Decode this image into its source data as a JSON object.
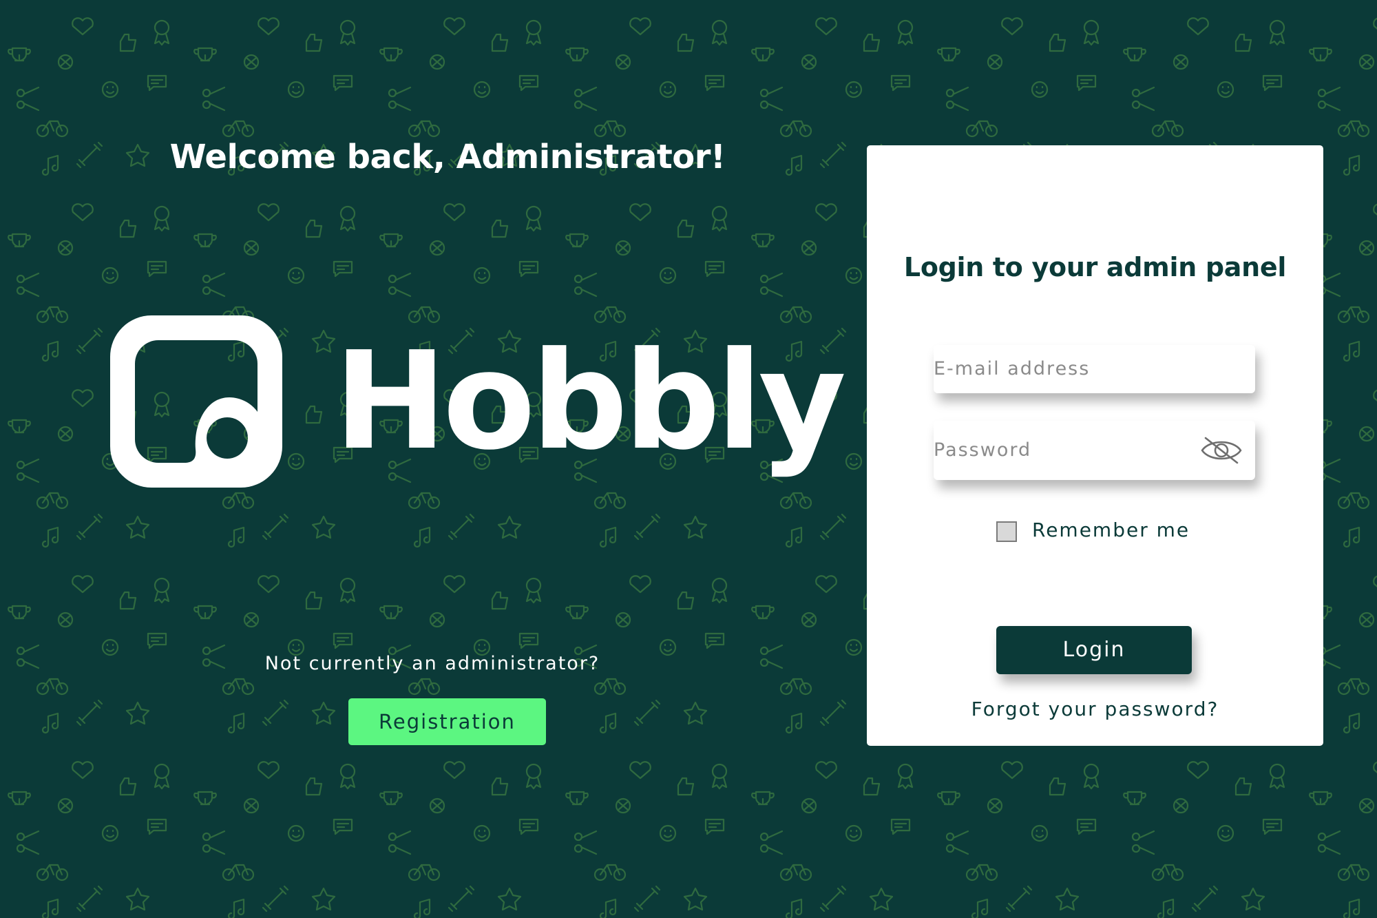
{
  "colors": {
    "background": "#0b3a38",
    "pattern": "#2f6a3f",
    "accent_green": "#5cf681",
    "card": "#ffffff",
    "dark_text": "#0b3a38"
  },
  "left_panel": {
    "welcome": "Welcome back, Administrator!",
    "brand_name": "Hobbly",
    "not_admin_text": "Not currently an administrator?",
    "registration_label": "Registration"
  },
  "login_card": {
    "title": "Login to your admin panel",
    "email_placeholder": "E-mail address",
    "password_placeholder": "Password",
    "password_toggle_icon": "eye-off-icon",
    "remember_label": "Remember me",
    "remember_checked": false,
    "login_label": "Login",
    "forgot_label": "Forgot your password?"
  }
}
